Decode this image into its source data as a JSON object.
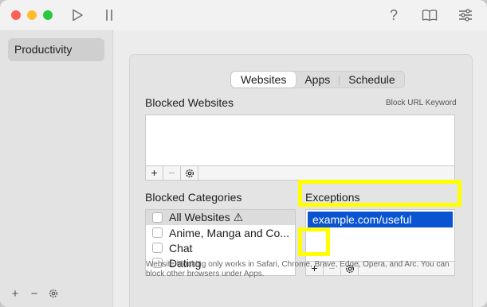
{
  "toolbar": {
    "play_icon": "play-icon",
    "pause_icon": "pause-icon",
    "help_label": "?",
    "book_icon": "book-icon",
    "settings_icon": "sliders-icon"
  },
  "sidebar": {
    "items": [
      {
        "label": "Productivity"
      }
    ],
    "add_label": "+",
    "remove_label": "−"
  },
  "tabs": [
    {
      "label": "Websites",
      "active": true
    },
    {
      "label": "Apps",
      "active": false
    },
    {
      "label": "Schedule",
      "active": false
    }
  ],
  "blocked_websites": {
    "title": "Blocked Websites",
    "keyword_link": "Block URL Keyword",
    "add_label": "+",
    "remove_label": "−"
  },
  "blocked_categories": {
    "title": "Blocked Categories",
    "items": [
      {
        "label": "All Websites ⚠"
      },
      {
        "label": "Anime, Manga and Co..."
      },
      {
        "label": "Chat"
      },
      {
        "label": "Dating"
      }
    ]
  },
  "exceptions": {
    "title": "Exceptions",
    "items": [
      {
        "label": "example.com/useful",
        "selected": true
      }
    ],
    "add_label": "+",
    "remove_label": "−"
  },
  "footnote": "Website blocking only works in Safari, Chrome, Brave, Edge, Opera, and Arc. You can block other browsers under Apps.",
  "colors": {
    "accent": "#0a54d1",
    "highlight": "#ffff00"
  }
}
